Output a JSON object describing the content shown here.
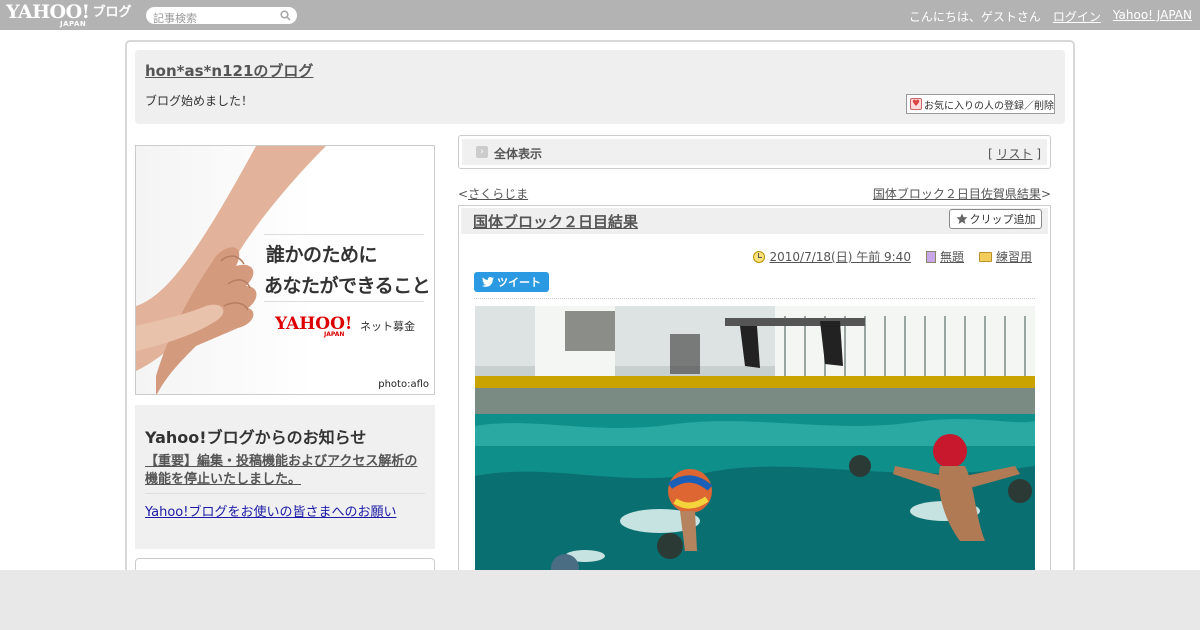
{
  "topbar": {
    "logo_text": "YAHOO!",
    "logo_sub": "JAPAN",
    "logo_blog": "ブログ",
    "search_placeholder": "記事検索",
    "greeting": "こんにちは、ゲストさん",
    "login": "ログイン",
    "yahoo_japan": "Yahoo! JAPAN"
  },
  "header": {
    "blog_title": "hon*as*n121のブログ",
    "blog_description": "ブログ始めました！",
    "favorite_button": "お気に入りの人の登録／削除"
  },
  "banner": {
    "line1": "誰かのために",
    "line2": "あなたができること",
    "brand": "YAHOO!",
    "brand_sub": "JAPAN",
    "fund": "ネット募金",
    "credit": "photo:aflo"
  },
  "notice": {
    "heading": "Yahoo!ブログからのお知らせ",
    "item1": "【重要】編集・投稿機能およびアクセス解析の機能を停止いたしました。",
    "item2": "Yahoo!ブログをお使いの皆さまへのお願い"
  },
  "view_bar": {
    "label": "全体表示",
    "bracket_open": "[",
    "list_link": "リスト",
    "bracket_close": "]"
  },
  "nav": {
    "prev_mark": "<",
    "prev": "さくらじま",
    "next": "国体ブロック２日目佐賀県結果",
    "next_mark": ">"
  },
  "article": {
    "title": "国体ブロック２日目結果",
    "clip_button": "クリップ追加",
    "date": "2010/7/18(日) 午前 9:40",
    "theme": "無題",
    "category": "練習用",
    "tweet_button": "ツイート"
  },
  "colors": {
    "topbar": "#b3b3b3",
    "tweet": "#2b9ae2",
    "link_blue": "#1a1aa6"
  }
}
